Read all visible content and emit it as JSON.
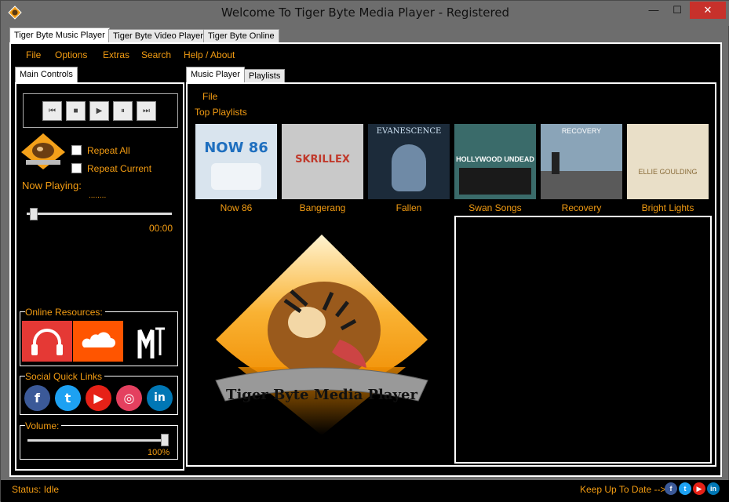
{
  "window": {
    "title": "Welcome To Tiger Byte Media Player - Registered",
    "min_glyph": "—",
    "max_glyph": "☐",
    "close_glyph": "✕"
  },
  "outer_tabs": [
    "Tiger Byte Music Player",
    "Tiger Byte Video Player",
    "Tiger Byte Online"
  ],
  "menu": [
    "File",
    "Options",
    "Extras",
    "Search",
    "Help / About"
  ],
  "left_panel": {
    "tab": "Main Controls",
    "transport_icons": [
      "skip-back-icon",
      "stop-icon",
      "play-icon",
      "pause-icon",
      "skip-forward-icon"
    ],
    "transport_glyphs": [
      "⏮",
      "■",
      "▶",
      "⏸",
      "⏭"
    ],
    "repeat_all": "Repeat All",
    "repeat_current": "Repeat Current",
    "now_playing_label": "Now Playing:",
    "now_playing_value": "........",
    "seek_position": 0.02,
    "time": "00:00",
    "online_resources_label": "Online Resources:",
    "online_resources": [
      {
        "icon": "headphones-icon",
        "color": "#e53935"
      },
      {
        "icon": "soundcloud-icon",
        "color": "#ff5500"
      },
      {
        "icon": "mtv-icon",
        "color": "#000000"
      }
    ],
    "social_label": "Social Quick Links",
    "social": [
      {
        "icon": "facebook-icon",
        "glyph": "f",
        "color": "#3b5998"
      },
      {
        "icon": "twitter-icon",
        "glyph": "t",
        "color": "#1da1f2"
      },
      {
        "icon": "youtube-icon",
        "glyph": "▶",
        "color": "#e62117"
      },
      {
        "icon": "instagram-icon",
        "glyph": "◎",
        "color": "#e4405f"
      },
      {
        "icon": "linkedin-icon",
        "glyph": "in",
        "color": "#0077b5"
      }
    ],
    "volume_label": "Volume:",
    "volume_value": "100%",
    "volume_level": 1.0
  },
  "right_panel": {
    "tabs": [
      "Music Player",
      "Playlists"
    ],
    "file_menu": "File",
    "top_playlists_label": "Top Playlists",
    "albums": [
      {
        "label": "Now 86",
        "art_text": "NOW 86",
        "bg": "#d9e4ee",
        "fg": "#1f6fbf"
      },
      {
        "label": "Bangerang",
        "art_text": "SKRILLEX",
        "bg": "#c9c9c9",
        "fg": "#c0392b"
      },
      {
        "label": "Fallen",
        "art_text": "EVANESCENCE",
        "bg": "#1c2b3a",
        "fg": "#d0e4f5"
      },
      {
        "label": "Swan Songs",
        "art_text": "HOLLYWOOD UNDEAD",
        "bg": "#3a6b6a",
        "fg": "#ffffff"
      },
      {
        "label": "Recovery",
        "art_text": "RECOVERY",
        "bg": "#8aa4b8",
        "fg": "#ffffff"
      },
      {
        "label": "Bright Lights",
        "art_text": "ELLIE GOULDING",
        "bg": "#e9dfc8",
        "fg": "#8a6d3b"
      }
    ],
    "logo_text": "Tiger Byte Media Player"
  },
  "status": {
    "text": "Status: Idle",
    "keep_up": "Keep Up To Date -->"
  },
  "colors": {
    "accent": "#f39c12",
    "panel_bg": "#000000",
    "chrome": "#6d6d6d"
  }
}
